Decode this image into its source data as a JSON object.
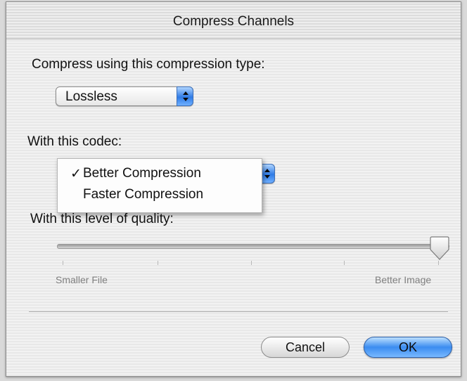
{
  "window": {
    "title": "Compress Channels"
  },
  "compression": {
    "label": "Compress using this compression type:",
    "selected": "Lossless"
  },
  "codec": {
    "label": "With this codec:",
    "menu_items": [
      {
        "label": "Better Compression",
        "checked": true
      },
      {
        "label": "Faster Compression",
        "checked": false
      }
    ],
    "check_mark": "✓"
  },
  "quality": {
    "label": "With this level of quality:",
    "min_label": "Smaller File",
    "max_label": "Better Image",
    "value_fraction": 1.0
  },
  "buttons": {
    "cancel": "Cancel",
    "ok": "OK"
  },
  "colors": {
    "accent": "#3b8cf0"
  }
}
